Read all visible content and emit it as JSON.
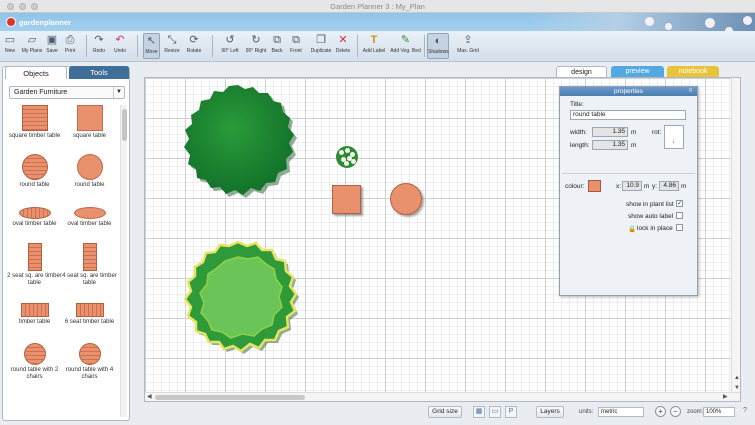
{
  "window": {
    "title": "Garden Planner 3 : My_Plan"
  },
  "logo": {
    "text": "gardenplanner"
  },
  "toolbar": {
    "new": "New",
    "my_plans": "My Plans",
    "save": "Save",
    "print": "Print",
    "redo": "Redo",
    "undo": "Undo",
    "move": "Move",
    "resize": "Resize",
    "rotate": "Rotate",
    "rot_left": "90° Left",
    "rot_right": "90° Right",
    "back": "Back",
    "front": "Front",
    "duplicate": "Duplicate",
    "delete": "Delete",
    "add_label": "Add Label",
    "add_veg_bed": "Add Veg. Bed",
    "shadows": "Shadows",
    "max_grid": "Max. Grid"
  },
  "left_panel": {
    "tab_objects": "Objects",
    "tab_tools": "Tools",
    "category": "Garden Furniture",
    "items": [
      {
        "label": "square timber table"
      },
      {
        "label": "square table"
      },
      {
        "label": "round table"
      },
      {
        "label": "round table"
      },
      {
        "label": "oval timber table"
      },
      {
        "label": "oval timber table"
      },
      {
        "label": "2 seat sq. are timber table"
      },
      {
        "label": "4 seat sq. are timber table"
      },
      {
        "label": "timber table"
      },
      {
        "label": "6 seat timber table"
      },
      {
        "label": "round table with 2 chairs"
      },
      {
        "label": "round table with 4 chairs"
      }
    ]
  },
  "view_tabs": {
    "design": "design",
    "preview": "preview",
    "notebook": "notebook"
  },
  "properties": {
    "header": "properties",
    "title_label": "Title:",
    "title_value": "round table",
    "width_label": "width:",
    "width_value": "1.35",
    "length_label": "length:",
    "length_value": "1.35",
    "unit_m": "m",
    "rot_label": "rot:",
    "rot_value": "↓",
    "colour_label": "colour:",
    "x_label": "x:",
    "x_value": "10.9",
    "y_label": "y:",
    "y_value": "4.86",
    "colour": "#e8916c",
    "show_in_plant_list": "show in plant list",
    "show_auto_label": "show auto label",
    "lock_in_place": "lock in place",
    "check_mark": "✓"
  },
  "bottom": {
    "grid_size": "Grid size",
    "layers": "Layers",
    "units_label": "units:",
    "units_value": "metric",
    "zoom_label": "zoom:",
    "zoom_value": "100%",
    "p_label": "P"
  },
  "colors": {
    "accent": "#3f6e97",
    "preview_tab": "#52a8e2",
    "notebook_tab": "#e8c43a",
    "table": "#e8916c",
    "tree": "#1f8a2e"
  }
}
